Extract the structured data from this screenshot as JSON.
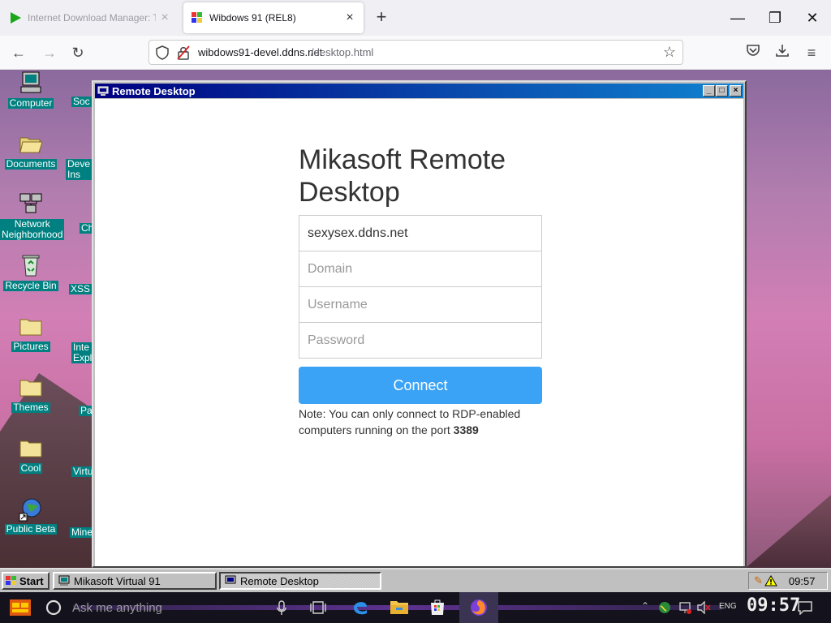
{
  "browser": {
    "tabs": [
      {
        "label": "Internet Download Manager: The fa",
        "active": false
      },
      {
        "label": "Wibdows 91 (REL8)",
        "active": true
      }
    ],
    "url_domain": "wibdows91-devel.ddns.net",
    "url_path": "/desktop.html"
  },
  "desktop": {
    "icons": [
      {
        "label": "Computer",
        "icon": "computer-icon"
      },
      {
        "label": "Documents",
        "icon": "folder-open-icon"
      },
      {
        "label": "Network\nNeighborhood",
        "icon": "network-icon"
      },
      {
        "label": "Recycle Bin",
        "icon": "recycle-bin-icon"
      },
      {
        "label": "Pictures",
        "icon": "folder-icon"
      },
      {
        "label": "Themes",
        "icon": "folder-icon"
      },
      {
        "label": "Cool",
        "icon": "folder-icon"
      },
      {
        "label": "Public Beta",
        "icon": "globe-shortcut-icon"
      }
    ],
    "icons_col2": [
      {
        "label": "Soc"
      },
      {
        "label": "Deve\nIns"
      },
      {
        "label": "Ch"
      },
      {
        "label": "XSS"
      },
      {
        "label": "Inte\nExpl"
      },
      {
        "label": "Pa"
      },
      {
        "label": "Virtu"
      },
      {
        "label": "Mine"
      }
    ]
  },
  "window": {
    "title": "Remote Desktop",
    "heading": "Mikasoft Remote Desktop",
    "host_value": "sexysex.ddns.net",
    "domain_placeholder": "Domain",
    "username_placeholder": "Username",
    "password_placeholder": "Password",
    "connect_label": "Connect",
    "note_text": "Note: You can only connect to RDP-enabled computers running on the port ",
    "note_port": "3389"
  },
  "taskbar": {
    "start_label": "Start",
    "tasks": [
      {
        "label": "Mikasoft Virtual 91",
        "active": false
      },
      {
        "label": "Remote Desktop",
        "active": true
      }
    ],
    "clock": "09:57"
  },
  "host_taskbar": {
    "search_placeholder": "Ask me anything",
    "language": "ENG",
    "time": "09:57"
  },
  "colors": {
    "title_gradient_start": "#000080",
    "title_gradient_end": "#1084d0",
    "connect_button": "#3aa3f5",
    "desktop_label_bg": "#008080"
  }
}
